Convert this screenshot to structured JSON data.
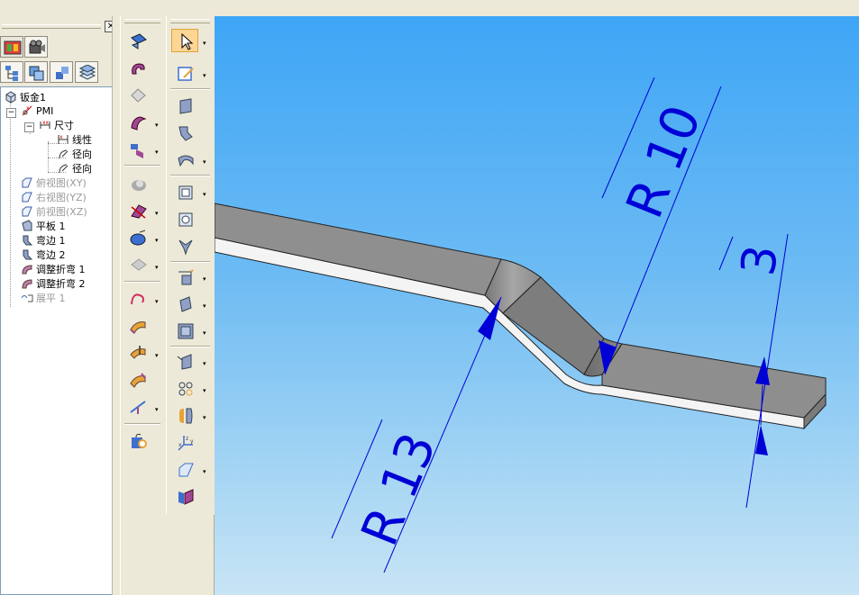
{
  "tree": {
    "root": "钣金1",
    "pmi": "PMI",
    "dimensions": "尺寸",
    "dim_linear": "线性",
    "dim_radial_1": "径向",
    "dim_radial_2": "径向",
    "view_top": "俯视图(XY)",
    "view_right": "右视图(YZ)",
    "view_front": "前视图(XZ)",
    "tab": "平板 1",
    "flange_1": "弯边 1",
    "flange_2": "弯边 2",
    "bend_1": "调整折弯 1",
    "bend_2": "调整折弯 2",
    "flatten": "展平 1"
  },
  "dims": {
    "r10": "R 10",
    "r13": "R 13",
    "thickness": "3"
  },
  "panel": {
    "close_glyph": "✕"
  },
  "dropdown_glyph": "▾",
  "colors": {
    "dimension_blue": "#0000d6",
    "viewport_top": "#3ea6f6",
    "viewport_bottom": "#c8e4f5",
    "part_top_face": "#8e8e8e",
    "part_side_face": "#f4f4f4",
    "selection_highlight": "#fdd595"
  }
}
